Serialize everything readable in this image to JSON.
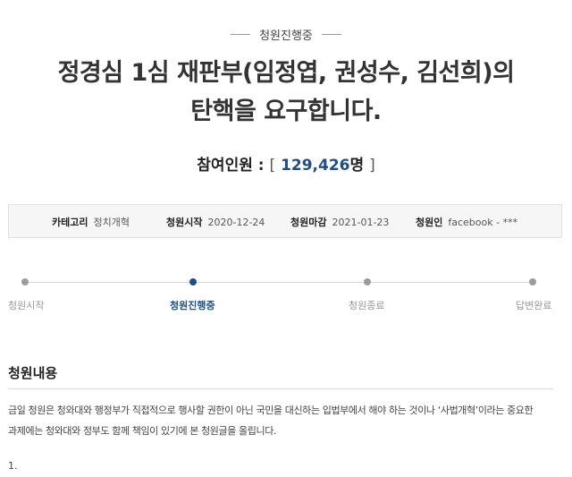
{
  "status": {
    "label": "청원진행중"
  },
  "petition": {
    "title_line1": "정경심 1심 재판부(임정엽, 권성수, 김선희)의",
    "title_line2": "탄핵을 요구합니다.",
    "participants_label": "참여인원 :",
    "participants_open": "[",
    "participants_count": "129,426",
    "participants_unit": "명",
    "participants_close": "]"
  },
  "info": {
    "category_label": "카테고리",
    "category_value": "정치개혁",
    "start_label": "청원시작",
    "start_value": "2020-12-24",
    "end_label": "청원마감",
    "end_value": "2021-01-23",
    "author_label": "청원인",
    "author_value": "facebook - ***"
  },
  "timeline": {
    "steps": [
      "청원시작",
      "청원진행중",
      "청원종료",
      "답변완료"
    ],
    "active_index": 1
  },
  "content": {
    "section_title": "청원내용",
    "paragraph_line1": "금일 청원은 청와대와 행정부가 직접적으로 행사할 권한이 아닌 국민을 대신하는 입법부에서 해야 하는 것이나 ‘사법개혁’이라는 중요한",
    "paragraph_line2": "과제에는 청와대와 정부도 함께 책임이 있기에 본 청원글을 올립니다.",
    "item_number": "1."
  },
  "colors": {
    "accent": "#1d4e89",
    "muted": "#999999"
  }
}
